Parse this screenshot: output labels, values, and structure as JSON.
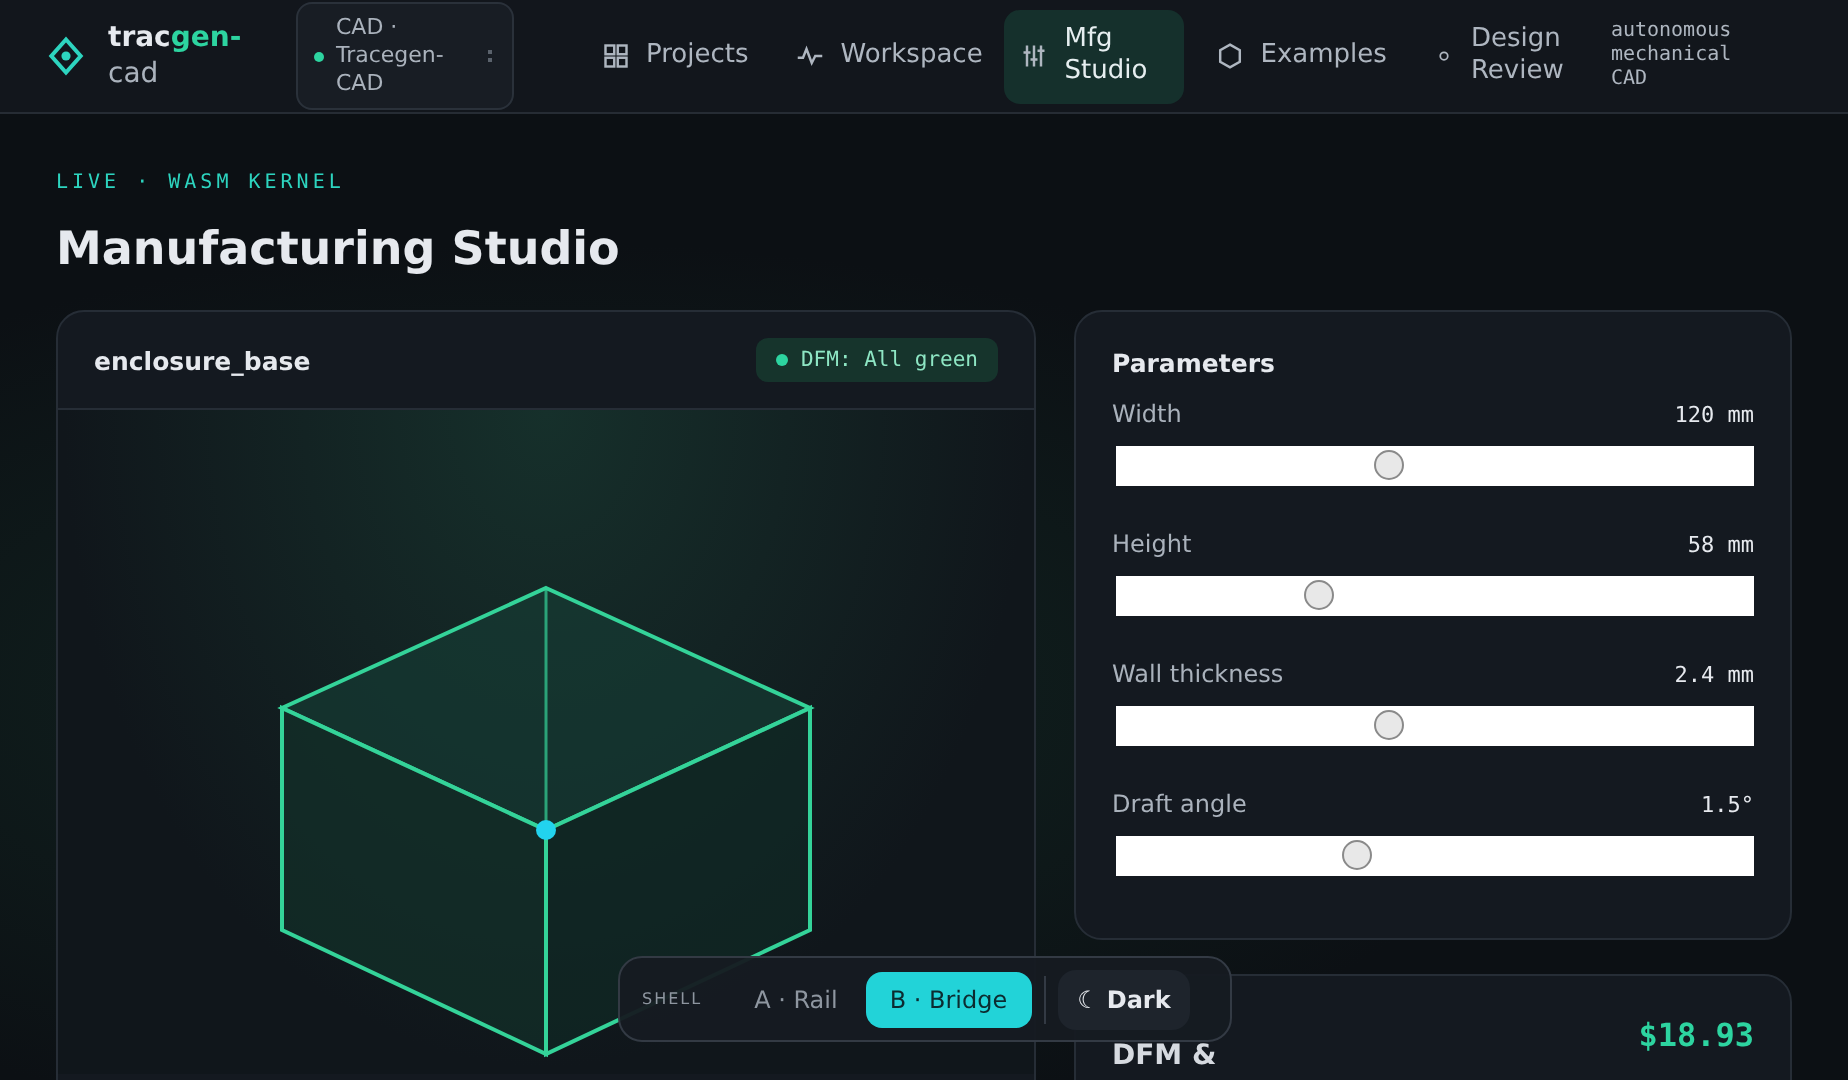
{
  "brand": {
    "name_start": "trac",
    "name_accent": "gen-",
    "name_end": "cad"
  },
  "project_switcher": {
    "label": "CAD · Tracegen-CAD"
  },
  "nav": [
    {
      "label": "Projects",
      "selected": false
    },
    {
      "label": "Workspace",
      "selected": false
    },
    {
      "label": "Mfg Studio",
      "selected": true
    },
    {
      "label": "Examples",
      "selected": false
    },
    {
      "label": "Design Review",
      "selected": false
    }
  ],
  "tagline": "autonomous mechanical CAD",
  "eyebrow": "LIVE · WASM KERNEL",
  "title": "Manufacturing Studio",
  "viewport": {
    "part_name": "enclosure_base",
    "badge": "DFM: All green"
  },
  "parameters": {
    "title": "Parameters",
    "items": [
      {
        "label": "Width",
        "reading": "120 mm",
        "level": 0.43
      },
      {
        "label": "Height",
        "reading": "58 mm",
        "level": 0.32
      },
      {
        "label": "Wall thickness",
        "reading": "2.4 mm",
        "level": 0.43
      },
      {
        "label": "Draft angle",
        "reading": "1.5°",
        "level": 0.38
      }
    ]
  },
  "cost_card": {
    "title": "DFM &",
    "price": "$18.93"
  },
  "shell_bar": {
    "label": "SHELL",
    "options": [
      {
        "label": "A · Rail",
        "selected": false
      },
      {
        "label": "B · Bridge",
        "selected": true
      }
    ],
    "theme_button": {
      "icon": "☾",
      "label": "Dark"
    }
  }
}
